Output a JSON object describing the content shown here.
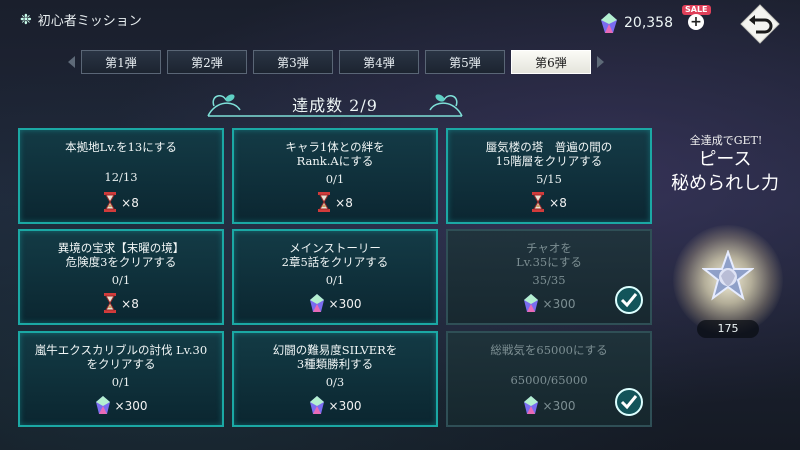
{
  "header": {
    "title": "初心者ミッション",
    "gem_count": "20,358",
    "sale_badge": "SALE"
  },
  "tabs": [
    {
      "label": "第1弾",
      "active": false
    },
    {
      "label": "第2弾",
      "active": false
    },
    {
      "label": "第3弾",
      "active": false
    },
    {
      "label": "第4弾",
      "active": false
    },
    {
      "label": "第5弾",
      "active": false
    },
    {
      "label": "第6弾",
      "active": true
    }
  ],
  "achievement": {
    "label": "達成数 2/9"
  },
  "missions": [
    {
      "name": "本拠地Lv.を13にする",
      "progress": "12/13",
      "reward_icon": "hourglass-icon",
      "reward_qty": "×8",
      "completed": false
    },
    {
      "name": "キャラ1体との絆を\nRank.Aにする",
      "progress": "0/1",
      "reward_icon": "hourglass-icon",
      "reward_qty": "×8",
      "completed": false
    },
    {
      "name": "蜃気楼の塔　普遍の間の\n15階層をクリアする",
      "progress": "5/15",
      "reward_icon": "hourglass-icon",
      "reward_qty": "×8",
      "completed": false
    },
    {
      "name": "異境の宝求【末曜の境】\n危険度3をクリアする",
      "progress": "0/1",
      "reward_icon": "hourglass-icon",
      "reward_qty": "×8",
      "completed": false
    },
    {
      "name": "メインストーリー\n2章5話をクリアする",
      "progress": "0/1",
      "reward_icon": "gem-icon",
      "reward_qty": "×300",
      "completed": false
    },
    {
      "name": "チャオを\nLv.35にする",
      "progress": "35/35",
      "reward_icon": "gem-icon",
      "reward_qty": "×300",
      "completed": true
    },
    {
      "name": "嵐牛エクスカリブルの討伐 Lv.30\nをクリアする",
      "progress": "0/1",
      "reward_icon": "gem-icon",
      "reward_qty": "×300",
      "completed": false
    },
    {
      "name": "幻闘の難易度SILVERを\n3種類勝利する",
      "progress": "0/3",
      "reward_icon": "gem-icon",
      "reward_qty": "×300",
      "completed": false
    },
    {
      "name": "総戦気を65000にする",
      "progress": "65000/65000",
      "reward_icon": "gem-icon",
      "reward_qty": "×300",
      "completed": true
    }
  ],
  "all_clear": {
    "caption": "全達成でGET!",
    "title": "ピース\n秘められし力",
    "count": "175"
  }
}
